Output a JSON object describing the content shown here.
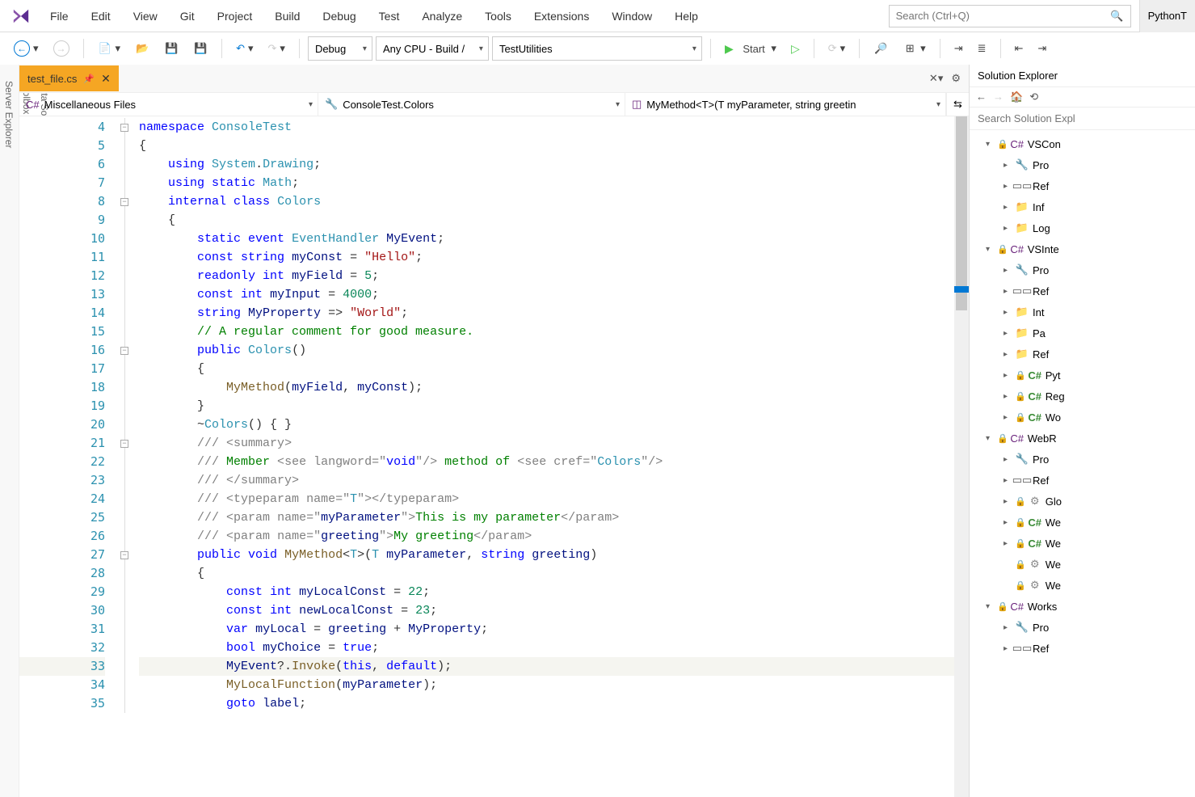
{
  "menubar": {
    "items": [
      "File",
      "Edit",
      "View",
      "Git",
      "Project",
      "Build",
      "Debug",
      "Test",
      "Analyze",
      "Tools",
      "Extensions",
      "Window",
      "Help"
    ],
    "search_placeholder": "Search (Ctrl+Q)",
    "right_button": "PythonT"
  },
  "toolbar": {
    "config_combo": "Debug",
    "platform_combo": "Any CPU - Build /",
    "startup_combo": "TestUtilities",
    "start_label": "Start"
  },
  "file_tab": {
    "name": "test_file.cs"
  },
  "nav": {
    "project": "Miscellaneous Files",
    "class": "ConsoleTest.Colors",
    "member": "MyMethod<T>(T myParameter, string greetin"
  },
  "code_lines": [
    {
      "n": 4,
      "fold": "box",
      "html": "<span class='kw'>namespace</span> <span class='type'>ConsoleTest</span>"
    },
    {
      "n": 5,
      "html": "{"
    },
    {
      "n": 6,
      "fold": "line",
      "html": "    <span class='kw'>using</span> <span class='type'>System</span>.<span class='type'>Drawing</span>;"
    },
    {
      "n": 7,
      "html": "    <span class='kw'>using static</span> <span class='type'>Math</span>;"
    },
    {
      "n": 8,
      "fold": "box",
      "html": "    <span class='kw'>internal</span> <span class='kw'>class</span> <span class='type'>Colors</span>"
    },
    {
      "n": 9,
      "html": "    {"
    },
    {
      "n": 10,
      "html": "        <span class='kw'>static</span> <span class='kw'>event</span> <span class='type'>EventHandler</span> <span class='ident'>MyEvent</span>;"
    },
    {
      "n": 11,
      "html": "        <span class='kw'>const</span> <span class='kw'>string</span> <span class='ident'>myConst</span> = <span class='str'>\"Hello\"</span>;"
    },
    {
      "n": 12,
      "html": "        <span class='kw'>readonly</span> <span class='kw'>int</span> <span class='ident'>myField</span> = <span class='num'>5</span>;"
    },
    {
      "n": 13,
      "html": "        <span class='kw'>const</span> <span class='kw'>int</span> <span class='ident'>myInput</span> = <span class='num'>4000</span>;"
    },
    {
      "n": 14,
      "html": "        <span class='kw'>string</span> <span class='ident'>MyProperty</span> =&gt; <span class='str'>\"World\"</span>;"
    },
    {
      "n": 15,
      "html": "        <span class='cmt'>// A regular comment for good measure.</span>"
    },
    {
      "n": 16,
      "fold": "box",
      "html": "        <span class='kw'>public</span> <span class='type'>Colors</span>()"
    },
    {
      "n": 17,
      "html": "        {"
    },
    {
      "n": 18,
      "html": "            <span class='method'>MyMethod</span>(<span class='ident'>myField</span>, <span class='ident'>myConst</span>);"
    },
    {
      "n": 19,
      "html": "        }"
    },
    {
      "n": 20,
      "html": "        ~<span class='type'>Colors</span>() { }"
    },
    {
      "n": 21,
      "fold": "box",
      "html": "        <span class='doc'>/// </span><span class='doc'>&lt;</span><span class='doc'>summary</span><span class='doc'>&gt;</span>"
    },
    {
      "n": 22,
      "html": "        <span class='doc'>/// </span><span class='doctext'>Member </span><span class='doc'>&lt;</span><span class='doc'>see</span> <span class='docattr'>langword</span><span class='doc'>=</span><span class='doc'>\"</span><span class='kw'>void</span><span class='doc'>\"/&gt;</span><span class='doctext'> method of </span><span class='doc'>&lt;</span><span class='doc'>see</span> <span class='docattr'>cref</span><span class='doc'>=\"</span><span class='type'>Colors</span><span class='doc'>\"/&gt;</span>"
    },
    {
      "n": 23,
      "html": "        <span class='doc'>/// &lt;/summary&gt;</span>"
    },
    {
      "n": 24,
      "html": "        <span class='doc'>/// &lt;</span><span class='doc'>typeparam</span> <span class='docattr'>name</span><span class='doc'>=\"</span><span class='typegen'>T</span><span class='doc'>\"&gt;&lt;/</span><span class='doc'>typeparam</span><span class='doc'>&gt;</span>"
    },
    {
      "n": 25,
      "html": "        <span class='doc'>/// &lt;</span><span class='doc'>param</span> <span class='docattr'>name</span><span class='doc'>=\"</span><span class='ident'>myParameter</span><span class='doc'>\"&gt;</span><span class='doctext'>This is my parameter</span><span class='doc'>&lt;/</span><span class='doc'>param</span><span class='doc'>&gt;</span>"
    },
    {
      "n": 26,
      "html": "        <span class='doc'>/// &lt;</span><span class='doc'>param</span> <span class='docattr'>name</span><span class='doc'>=\"</span><span class='ident'>greeting</span><span class='doc'>\"&gt;</span><span class='doctext'>My greeting</span><span class='doc'>&lt;/</span><span class='doc'>param</span><span class='doc'>&gt;</span>"
    },
    {
      "n": 27,
      "fold": "box",
      "html": "        <span class='kw'>public</span> <span class='kw'>void</span> <span class='method'>MyMethod</span>&lt;<span class='typegen'>T</span>&gt;(<span class='typegen'>T</span> <span class='ident'>myParameter</span>, <span class='kw'>string</span> <span class='ident'>greeting</span>)"
    },
    {
      "n": 28,
      "html": "        {"
    },
    {
      "n": 29,
      "html": "            <span class='kw'>const</span> <span class='kw'>int</span> <span class='ident'>myLocalConst</span> = <span class='num'>22</span>;"
    },
    {
      "n": 30,
      "html": "            <span class='kw'>const</span> <span class='kw'>int</span> <span class='ident'>newLocalConst</span> = <span class='num'>23</span>;"
    },
    {
      "n": 31,
      "html": "            <span class='kw'>var</span> <span class='ident'>myLocal</span> = <span class='ident'>greeting</span> + <span class='ident'>MyProperty</span>;"
    },
    {
      "n": 32,
      "html": "            <span class='kw'>bool</span> <span class='ident'>myChoice</span> = <span class='kw'>true</span>;"
    },
    {
      "n": 33,
      "hl": true,
      "screwdriver": true,
      "html": "            <span class='ident'>MyEvent</span>?.<span class='method'>Invoke</span>(<span class='kw'>this</span>, <span class='kw'>default</span>);"
    },
    {
      "n": 34,
      "html": "            <span class='method'>MyLocalFunction</span>(<span class='ident'>myParameter</span>);"
    },
    {
      "n": 35,
      "html": "            <span class='kw'>goto</span> <span class='ident'>label</span>;"
    }
  ],
  "side_tabs": [
    "Server Explorer",
    "Toolbox",
    "Data Sources"
  ],
  "explorer": {
    "title": "Solution Explorer",
    "search_placeholder": "Search Solution Expl",
    "tree": [
      {
        "level": 1,
        "exp": "open",
        "lock": true,
        "icon": "csproj",
        "label": "VSCon"
      },
      {
        "level": 2,
        "exp": "closed",
        "icon": "wrench",
        "label": "Pro"
      },
      {
        "level": 2,
        "exp": "closed",
        "icon": "ref",
        "label": "Ref"
      },
      {
        "level": 2,
        "exp": "closed",
        "icon": "folder",
        "label": "Inf"
      },
      {
        "level": 2,
        "exp": "closed",
        "icon": "folder",
        "label": "Log"
      },
      {
        "level": 1,
        "exp": "open",
        "lock": true,
        "icon": "csproj",
        "label": "VSInte"
      },
      {
        "level": 2,
        "exp": "closed",
        "icon": "wrench",
        "label": "Pro"
      },
      {
        "level": 2,
        "exp": "closed",
        "icon": "ref",
        "label": "Ref"
      },
      {
        "level": 2,
        "exp": "closed",
        "icon": "folder",
        "label": "Int"
      },
      {
        "level": 2,
        "exp": "closed",
        "icon": "folder",
        "label": "Pa"
      },
      {
        "level": 2,
        "exp": "closed",
        "icon": "folder",
        "label": "Ref"
      },
      {
        "level": 2,
        "exp": "closed",
        "lock": true,
        "icon": "cs",
        "label": "Pyt"
      },
      {
        "level": 2,
        "exp": "closed",
        "lock": true,
        "icon": "cs",
        "label": "Reg"
      },
      {
        "level": 2,
        "exp": "closed",
        "lock": true,
        "icon": "cs",
        "label": "Wo"
      },
      {
        "level": 1,
        "exp": "open",
        "lock": true,
        "icon": "csproj",
        "label": "WebR"
      },
      {
        "level": 2,
        "exp": "closed",
        "icon": "wrench",
        "label": "Pro"
      },
      {
        "level": 2,
        "exp": "closed",
        "icon": "ref",
        "label": "Ref"
      },
      {
        "level": 2,
        "exp": "closed",
        "lock": true,
        "icon": "config",
        "label": "Glo"
      },
      {
        "level": 2,
        "exp": "closed",
        "lock": true,
        "icon": "cs",
        "label": "We"
      },
      {
        "level": 2,
        "exp": "closed",
        "lock": true,
        "icon": "cs",
        "label": "We"
      },
      {
        "level": 2,
        "exp": "none",
        "lock": true,
        "icon": "config",
        "label": "We"
      },
      {
        "level": 2,
        "exp": "none",
        "lock": true,
        "icon": "config",
        "label": "We"
      },
      {
        "level": 1,
        "exp": "open",
        "lock": true,
        "icon": "csproj",
        "label": "Works"
      },
      {
        "level": 2,
        "exp": "closed",
        "icon": "wrench",
        "label": "Pro"
      },
      {
        "level": 2,
        "exp": "closed",
        "icon": "ref",
        "label": "Ref"
      }
    ]
  }
}
